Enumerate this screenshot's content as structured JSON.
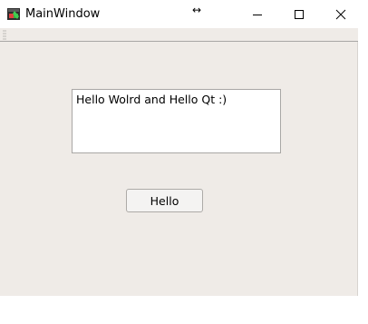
{
  "window": {
    "title": "MainWindow",
    "icons": {
      "app": "qt-app-icon",
      "resize": "horizontal-resize-cursor-icon",
      "minimize": "minimize-icon",
      "maximize": "maximize-icon",
      "close": "close-icon"
    }
  },
  "main": {
    "text_edit_value": "Hello Wolrd and Hello Qt :)",
    "button_label": "Hello"
  },
  "colors": {
    "window_bg": "#efebe7",
    "titlebar_bg": "#ffffff",
    "border": "#a9a7a5"
  }
}
